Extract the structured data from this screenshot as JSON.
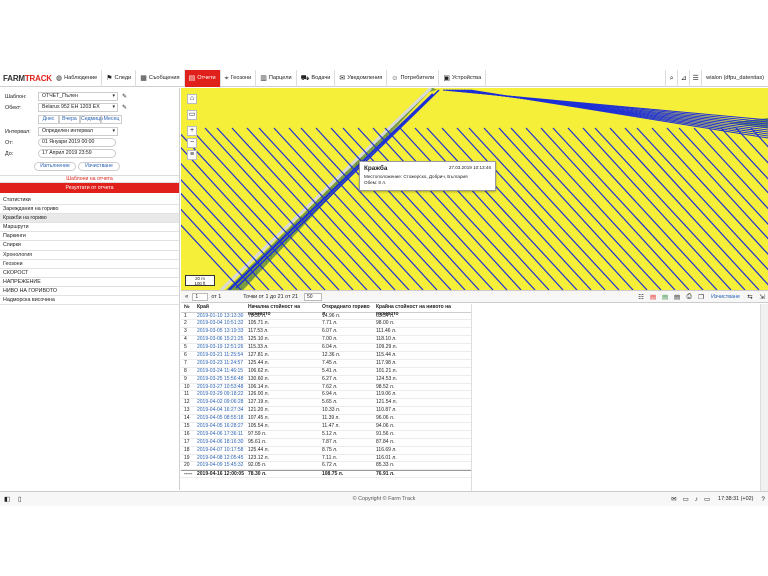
{
  "nav": {
    "logo_left": "FARM",
    "logo_right": "TRACK",
    "items": [
      {
        "icon": "globe",
        "label": "Наблюдение"
      },
      {
        "icon": "flag",
        "label": "Следи"
      },
      {
        "icon": "building",
        "label": "Съобщения"
      },
      {
        "icon": "chart",
        "label": "Отчети"
      },
      {
        "icon": "geozone",
        "label": "Геозони"
      },
      {
        "icon": "parcels",
        "label": "Парцели"
      },
      {
        "icon": "car",
        "label": "Водачи"
      },
      {
        "icon": "bell",
        "label": "Уведомления"
      },
      {
        "icon": "users",
        "label": "Потребители"
      },
      {
        "icon": "device",
        "label": "Устройства"
      }
    ],
    "active_item": "Отчети",
    "user": "wialon (dfpu_datenitas)"
  },
  "sidebar": {
    "template_label": "Шаблон:",
    "template_value": "ОТЧЕТ_Пълен",
    "object_label": "Обект:",
    "object_value": "Belarus 952 EH 1203 EX",
    "presets": [
      "Днес",
      "Вчера",
      "Седмица",
      "Месец"
    ],
    "interval_label": "Интервал:",
    "interval_value": "Определен интервал",
    "from_label": "От:",
    "from_value": "01 Януари 2019 00:00",
    "to_label": "До:",
    "to_value": "17 Април 2019 23:59",
    "execute": "Изпълнение",
    "clear": "Изчистване",
    "templates": "Шаблони на отчета",
    "result": "Резултати от отчета",
    "report_items": [
      "Статистики",
      "Зареждания на гориво",
      "Кражби на гориво",
      "Маршрути",
      "Паркинги",
      "Спирки",
      "Хронология",
      "Геозони",
      "СКОРОСТ",
      "НАПРЕЖЕНИЕ",
      "НИВО НА ГОРИВОТО",
      "Надморска височина"
    ],
    "selected_item": "Кражби на гориво"
  },
  "map": {
    "popup_title": "Кражба",
    "popup_date": "27.03.2019 10:13:46",
    "popup_location": "Местоположение: Стожерско, Добрич, България",
    "popup_volume": "Обем: 8 л.",
    "scale_top": "20 m",
    "scale_bottom": "100 ft"
  },
  "table_toolbar": {
    "page_prefix": "«",
    "page_value": "1",
    "page_of": "от 1",
    "rows_text": "Точки от 1 до 21 от 21",
    "page_size": "50",
    "clear_link": "Изчистване"
  },
  "table": {
    "headers": [
      "№",
      "Край",
      "Начална стойност на горивото",
      "Откраднато гориво л",
      "Крайна стойност на нивото на горивото"
    ],
    "rows": [
      [
        "1",
        "2019-01-10 13:13:30",
        "78.30 л.",
        "14.96 л.",
        "63.34 л."
      ],
      [
        "2",
        "2019-03-04 10:51:32",
        "105.71 л.",
        "7.71 л.",
        "98.00 л."
      ],
      [
        "3",
        "2019-03-05 13:19:33",
        "117.53 л.",
        "6.07 л.",
        "111.46 л."
      ],
      [
        "4",
        "2019-03-06 15:21:25",
        "125.10 л.",
        "7.00 л.",
        "118.10 л."
      ],
      [
        "5",
        "2019-03-19 12:51:26",
        "115.33 л.",
        "6.04 л.",
        "109.29 л."
      ],
      [
        "6",
        "2019-03-21 11:25:54",
        "127.81 л.",
        "12.36 л.",
        "115.44 л."
      ],
      [
        "7",
        "2019-03-23 11:24:57",
        "125.44 л.",
        "7.45 л.",
        "117.98 л."
      ],
      [
        "8",
        "2019-03-24 11:46:15",
        "106.62 л.",
        "5.41 л.",
        "101.21 л."
      ],
      [
        "9",
        "2019-03-25 15:56:48",
        "130.60 л.",
        "6.27 л.",
        "124.53 л."
      ],
      [
        "10",
        "2019-03-27 10:53:48",
        "106.14 л.",
        "7.62 л.",
        "98.52 л."
      ],
      [
        "11",
        "2019-03-29 09:18:22",
        "126.00 л.",
        "6.94 л.",
        "119.06 л."
      ],
      [
        "12",
        "2019-04-02 09:06:28",
        "127.19 л.",
        "5.65 л.",
        "121.54 л."
      ],
      [
        "13",
        "2019-04-04 16:27:34",
        "121.20 л.",
        "10.33 л.",
        "110.87 л."
      ],
      [
        "14",
        "2019-04-05 08:55:18",
        "107.45 л.",
        "11.39 л.",
        "96.06 л."
      ],
      [
        "15",
        "2019-04-05 16:28:27",
        "105.54 л.",
        "11.47 л.",
        "94.06 л."
      ],
      [
        "16",
        "2019-04-06 17:36:11",
        "97.59 л.",
        "5.12 л.",
        "91.56 л."
      ],
      [
        "17",
        "2019-04-06 18:16:30",
        "95.61 л.",
        "7.87 л.",
        "87.84 л."
      ],
      [
        "18",
        "2019-04-07 10:17:58",
        "125.44 л.",
        "8.75 л.",
        "116.69 л."
      ],
      [
        "19",
        "2019-04-08 12:05:45",
        "123.12 л.",
        "7.11 л.",
        "116.01 л."
      ],
      [
        "20",
        "2019-04-09 15:45:32",
        "92.05 л.",
        "6.72 л.",
        "85.33 л."
      ]
    ],
    "total": [
      "-----",
      "2019-04-16 12:00:05",
      "78.30 л.",
      "108.75 л.",
      "76.91 л."
    ]
  },
  "footer": {
    "copyright": "© Copyright © Farm Track",
    "clock": "17:38:31 (+02)"
  },
  "colors": {
    "accent": "#e0211b",
    "link": "#2a62b4",
    "field": "#f5ef3a",
    "track": "#1d2fd6"
  }
}
